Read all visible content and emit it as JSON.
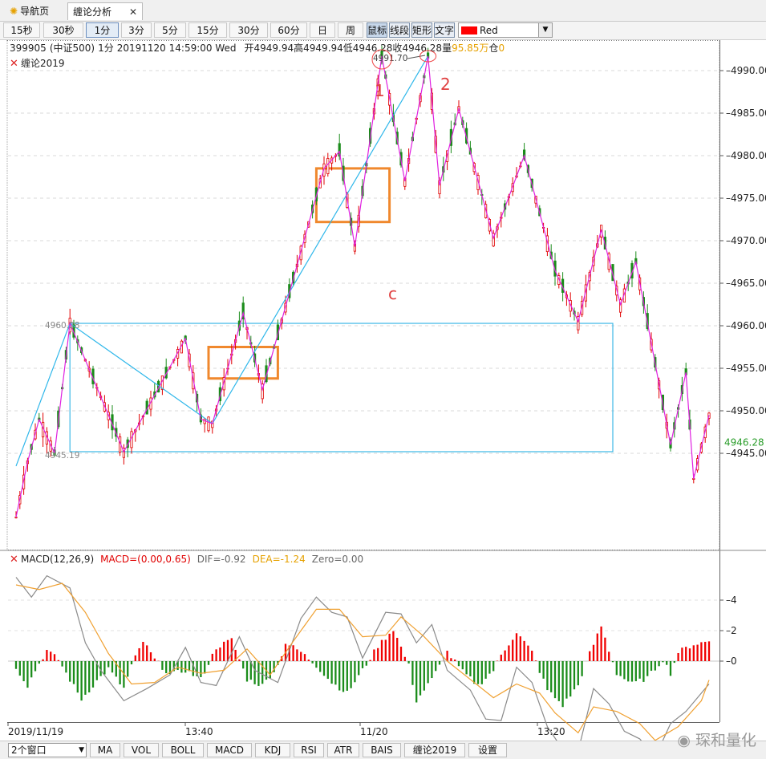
{
  "tabs": [
    {
      "label": "导航页",
      "icon": "sun-icon"
    },
    {
      "label": "缠论分析",
      "close": "✕"
    }
  ],
  "periods": [
    "15秒",
    "30秒",
    "1分",
    "3分",
    "5分",
    "15分",
    "30分",
    "60分",
    "日",
    "周"
  ],
  "active_period": "1分",
  "tools": [
    "鼠标",
    "线段",
    "矩形",
    "文字"
  ],
  "active_tool": "鼠标",
  "color_select": {
    "label": "Red",
    "color": "#ff0000"
  },
  "info": {
    "code": "399905",
    "name": "(中证500)",
    "period": "1分",
    "datetime": "20191120 14:59:00 Wed",
    "open_label": "开",
    "open": "4949.94",
    "high_label": "高",
    "high": "4949.94",
    "low_label": "低",
    "low": "4946.28",
    "close_label": "收",
    "close": "4946.28",
    "vol_label": "量",
    "vol": "95.85万",
    "pos_label": "仓",
    "pos": "0"
  },
  "indicator_label": "缠论2019",
  "macd": {
    "title": "MACD(12,26,9)",
    "macd_text": "MACD=(0.00,0.65)",
    "dif_text": "DIF=-0.92",
    "dea_text": "DEA=-1.24",
    "zero_text": "Zero=0.00",
    "yticks": [
      "4",
      "2",
      "0"
    ]
  },
  "bottom": {
    "window_select": "2个窗口",
    "buttons": [
      "MA",
      "VOL",
      "BOLL",
      "MACD",
      "KDJ",
      "RSI",
      "ATR",
      "BAIS",
      "缠论2019",
      "设置"
    ]
  },
  "watermark": "琛和量化",
  "chart_data": {
    "type": "candlestick",
    "ylim": [
      4937,
      4992
    ],
    "yticks": [
      4945,
      4950,
      4955,
      4960,
      4965,
      4970,
      4975,
      4980,
      4985,
      4990
    ],
    "ytick_labels": [
      "4945.00",
      "4950.00",
      "4955.00",
      "4960.00",
      "4965.00",
      "4970.00",
      "4975.00",
      "4980.00",
      "4985.00",
      "4990.00"
    ],
    "last_price": "4946.28",
    "xtick_labels": [
      "2019/11/19",
      "13:40",
      "11/20",
      "13:20"
    ],
    "price_labels": [
      {
        "text": "4960.28",
        "value": 4960.28
      },
      {
        "text": "4945.19",
        "value": 4945.19
      },
      {
        "text": "4991.70",
        "value": 4991.7
      }
    ],
    "annotations": [
      "1",
      "2",
      "c"
    ],
    "fractal_path": [
      [
        0,
        4937.5
      ],
      [
        3,
        4944
      ],
      [
        6,
        4949
      ],
      [
        10,
        4945
      ],
      [
        14,
        4960.28
      ],
      [
        28,
        4945.19
      ],
      [
        44,
        4958.5
      ],
      [
        48,
        4949
      ],
      [
        51,
        4948.5
      ],
      [
        59,
        4961.5
      ],
      [
        64,
        4952.5
      ],
      [
        80,
        4978.5
      ],
      [
        84,
        4980.5
      ],
      [
        88,
        4969.3
      ],
      [
        95,
        4991.7
      ],
      [
        101,
        4977
      ],
      [
        107,
        4991.7
      ],
      [
        110,
        4976.5
      ],
      [
        115,
        4985.5
      ],
      [
        124,
        4970.3
      ],
      [
        132,
        4980
      ],
      [
        140,
        4966.5
      ],
      [
        146,
        4960.5
      ],
      [
        152,
        4971.3
      ],
      [
        157,
        4962.5
      ],
      [
        161,
        4967.5
      ],
      [
        170,
        4946
      ],
      [
        174,
        4954.5
      ],
      [
        176,
        4942
      ],
      [
        180,
        4949.5
      ]
    ],
    "segment_path": [
      [
        0,
        4943.5
      ],
      [
        14,
        4960.28
      ],
      [
        51,
        4948.5
      ],
      [
        107,
        4991.7
      ]
    ],
    "pivot_box": {
      "x0": 14,
      "x1": 155,
      "y_low": 4945.19,
      "y_high": 4960.28
    },
    "highlight_boxes": [
      {
        "x0": 50,
        "x1": 68,
        "y_low": 4953.8,
        "y_high": 4957.5
      },
      {
        "x0": 78,
        "x1": 97,
        "y_low": 4972.2,
        "y_high": 4978.5
      }
    ],
    "macd_ylim": [
      -7,
      6.5
    ],
    "dif": [
      [
        0,
        5.5
      ],
      [
        4,
        4.2
      ],
      [
        8,
        5.6
      ],
      [
        14,
        4.8
      ],
      [
        18,
        1.2
      ],
      [
        22,
        -0.6
      ],
      [
        28,
        -2.6
      ],
      [
        34,
        -1.8
      ],
      [
        40,
        -0.9
      ],
      [
        44,
        0.9
      ],
      [
        48,
        -1.4
      ],
      [
        52,
        -1.6
      ],
      [
        58,
        1.6
      ],
      [
        62,
        -0.6
      ],
      [
        68,
        -1.4
      ],
      [
        74,
        2.8
      ],
      [
        78,
        4.2
      ],
      [
        82,
        3.2
      ],
      [
        86,
        2.9
      ],
      [
        90,
        0.2
      ],
      [
        96,
        3.2
      ],
      [
        100,
        3.1
      ],
      [
        104,
        1.2
      ],
      [
        108,
        2.4
      ],
      [
        112,
        -0.6
      ],
      [
        118,
        -1.9
      ],
      [
        122,
        -3.8
      ],
      [
        126,
        -3.9
      ],
      [
        130,
        -0.4
      ],
      [
        134,
        -1.4
      ],
      [
        138,
        -4.3
      ],
      [
        142,
        -5.8
      ],
      [
        146,
        -5.9
      ],
      [
        150,
        -1.8
      ],
      [
        154,
        -2.8
      ],
      [
        158,
        -4.6
      ],
      [
        162,
        -5.1
      ],
      [
        166,
        -6.3
      ],
      [
        170,
        -4.1
      ],
      [
        174,
        -3.3
      ],
      [
        178,
        -2.1
      ],
      [
        180,
        -1.5
      ]
    ],
    "dea": [
      [
        0,
        5.0
      ],
      [
        6,
        4.7
      ],
      [
        12,
        5.1
      ],
      [
        18,
        3.2
      ],
      [
        24,
        0.5
      ],
      [
        30,
        -1.5
      ],
      [
        36,
        -1.4
      ],
      [
        42,
        -0.4
      ],
      [
        48,
        -0.8
      ],
      [
        54,
        -0.6
      ],
      [
        60,
        0.8
      ],
      [
        66,
        -0.9
      ],
      [
        72,
        1.3
      ],
      [
        78,
        3.4
      ],
      [
        84,
        3.4
      ],
      [
        90,
        1.6
      ],
      [
        96,
        1.7
      ],
      [
        100,
        2.9
      ],
      [
        106,
        1.6
      ],
      [
        112,
        0.0
      ],
      [
        118,
        -1.2
      ],
      [
        124,
        -2.4
      ],
      [
        130,
        -1.5
      ],
      [
        136,
        -2.1
      ],
      [
        140,
        -3.4
      ],
      [
        146,
        -4.7
      ],
      [
        150,
        -3.0
      ],
      [
        156,
        -3.3
      ],
      [
        162,
        -4.1
      ],
      [
        166,
        -5.2
      ],
      [
        172,
        -4.3
      ],
      [
        178,
        -2.6
      ],
      [
        180,
        -1.24
      ]
    ],
    "hist_envelope": [
      [
        0,
        -0.4
      ],
      [
        3,
        -1.6
      ],
      [
        5,
        -0.6
      ],
      [
        8,
        0.7
      ],
      [
        11,
        0.1
      ],
      [
        13,
        -0.8
      ],
      [
        17,
        -2.5
      ],
      [
        21,
        -1.3
      ],
      [
        24,
        -0.5
      ],
      [
        28,
        -1.8
      ],
      [
        30,
        -0.3
      ],
      [
        33,
        1.3
      ],
      [
        36,
        0.1
      ],
      [
        40,
        -0.9
      ],
      [
        44,
        -0.6
      ],
      [
        48,
        -1.2
      ],
      [
        52,
        0.9
      ],
      [
        56,
        1.4
      ],
      [
        60,
        -1.2
      ],
      [
        64,
        -1.6
      ],
      [
        68,
        -0.3
      ],
      [
        70,
        1.2
      ],
      [
        74,
        0.6
      ],
      [
        78,
        -0.3
      ],
      [
        82,
        -1.4
      ],
      [
        86,
        -2.1
      ],
      [
        90,
        -0.6
      ],
      [
        94,
        1.0
      ],
      [
        98,
        2.1
      ],
      [
        102,
        -0.3
      ],
      [
        104,
        -2.6
      ],
      [
        108,
        -1.2
      ],
      [
        112,
        0.6
      ],
      [
        116,
        -0.7
      ],
      [
        120,
        -1.6
      ],
      [
        124,
        -0.6
      ],
      [
        126,
        0.4
      ],
      [
        130,
        1.9
      ],
      [
        134,
        0.6
      ],
      [
        138,
        -1.9
      ],
      [
        142,
        -2.9
      ],
      [
        146,
        -1.6
      ],
      [
        148,
        -0.1
      ],
      [
        152,
        2.3
      ],
      [
        154,
        0.7
      ],
      [
        156,
        -0.8
      ],
      [
        160,
        -1.5
      ],
      [
        164,
        -1.1
      ],
      [
        168,
        0.1
      ],
      [
        170,
        -0.8
      ],
      [
        172,
        0.6
      ],
      [
        176,
        1.1
      ],
      [
        180,
        1.3
      ]
    ]
  }
}
